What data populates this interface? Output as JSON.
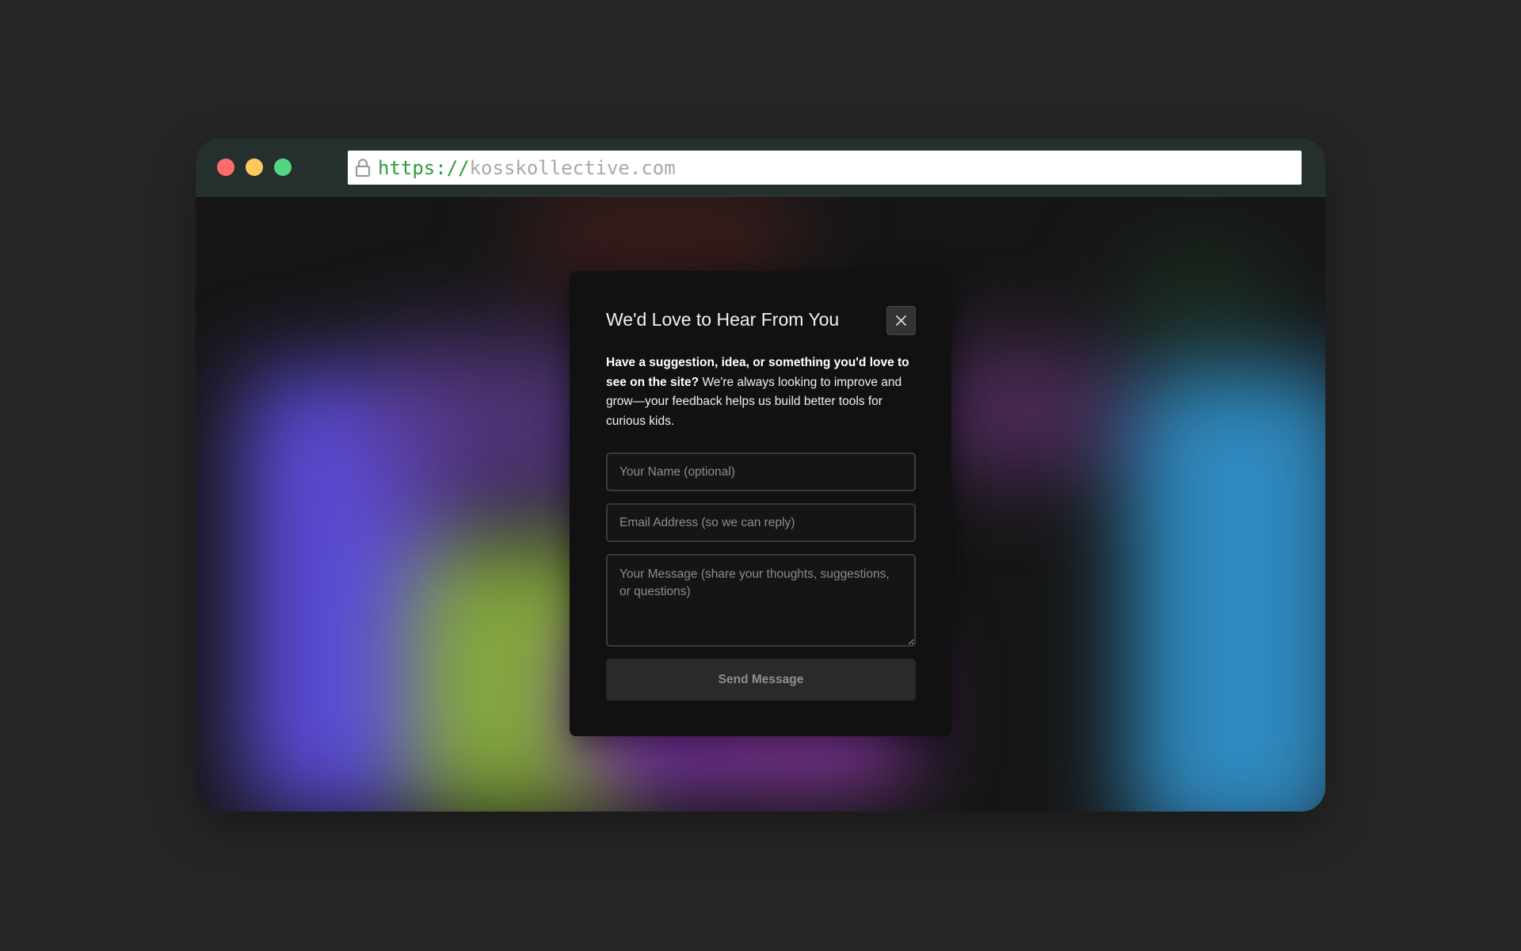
{
  "browser": {
    "url_scheme": "https://",
    "url_host": "kosskollective.com",
    "traffic_lights": {
      "close_color": "#ff6b6b",
      "minimize_color": "#ffc95e",
      "maximize_color": "#52d681"
    }
  },
  "modal": {
    "title": "We'd Love to Hear From You",
    "intro_bold": "Have a suggestion, idea, or something you'd love to see on the site?",
    "intro_text": " We're always looking to improve and grow—your feedback helps us build better tools for curious kids.",
    "name_placeholder": "Your Name (optional)",
    "email_placeholder": "Email Address (so we can reply)",
    "message_placeholder": "Your Message (share your thoughts, suggestions, or questions)",
    "submit_label": "Send Message",
    "close_icon": "close-icon"
  },
  "colors": {
    "page_background": "#262626",
    "titlebar": "#25302e",
    "modal_background": "#111111",
    "url_scheme": "#2a9d3a",
    "url_host": "#a8a8a8"
  }
}
